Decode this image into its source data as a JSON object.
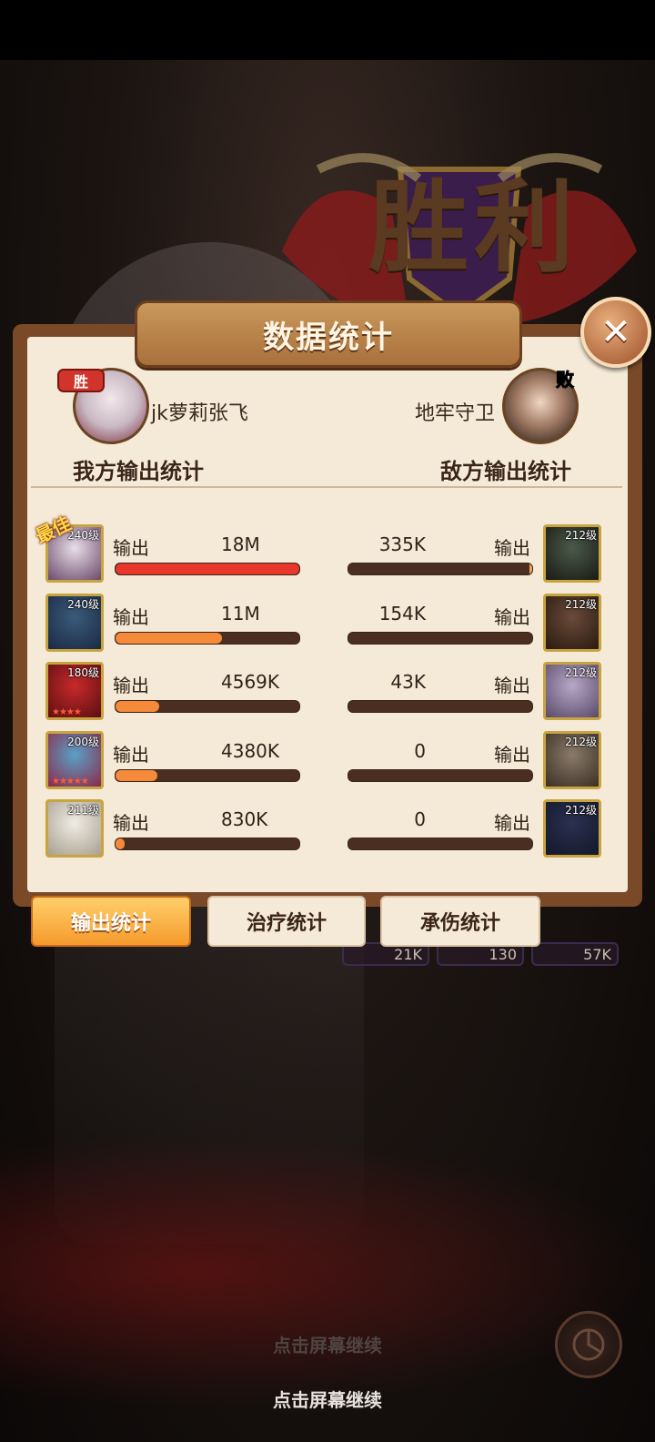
{
  "victory": {
    "text": "胜利"
  },
  "panel": {
    "title": "数据统计"
  },
  "players": {
    "ally": {
      "name": "jk萝莉张飞",
      "section_title": "我方输出统计"
    },
    "enemy": {
      "name": "地牢守卫",
      "section_title": "敌方输出统计"
    }
  },
  "best_badge": "最佳",
  "rows": [
    {
      "ally": {
        "level": "240级",
        "label": "输出",
        "value": "18M",
        "fraction": 1.0,
        "color": "#e8362a",
        "stars": 0
      },
      "enemy": {
        "level": "212级",
        "label": "输出",
        "value": "335K",
        "fraction": 1.0,
        "color": "#f5a35a"
      }
    },
    {
      "ally": {
        "level": "240级",
        "label": "输出",
        "value": "11M",
        "fraction": 0.58,
        "color": "#f58a3a",
        "stars": 0
      },
      "enemy": {
        "level": "212级",
        "label": "输出",
        "value": "154K",
        "fraction": 0.0,
        "color": "#f5a35a"
      }
    },
    {
      "ally": {
        "level": "180级",
        "label": "输出",
        "value": "4569K",
        "fraction": 0.24,
        "color": "#f58a3a",
        "stars": 4
      },
      "enemy": {
        "level": "212级",
        "label": "输出",
        "value": "43K",
        "fraction": 0.0,
        "color": "#f5a35a"
      }
    },
    {
      "ally": {
        "level": "200级",
        "label": "输出",
        "value": "4380K",
        "fraction": 0.23,
        "color": "#f58a3a",
        "stars": 5
      },
      "enemy": {
        "level": "212级",
        "label": "输出",
        "value": "0",
        "fraction": 0.0,
        "color": "#f5a35a"
      }
    },
    {
      "ally": {
        "level": "211级",
        "label": "输出",
        "value": "830K",
        "fraction": 0.05,
        "color": "#f58a3a",
        "stars": 0
      },
      "enemy": {
        "level": "212级",
        "label": "输出",
        "value": "0",
        "fraction": 0.0,
        "color": "#f5a35a"
      }
    }
  ],
  "tabs": [
    {
      "label": "输出统计",
      "active": true
    },
    {
      "label": "治疗统计",
      "active": false
    },
    {
      "label": "承伤统计",
      "active": false
    }
  ],
  "background_counts": [
    "21K",
    "130",
    "57K"
  ],
  "continue_hints": [
    "点击屏幕继续",
    "点击屏幕继续"
  ],
  "colors": {
    "panel_border": "#7a4a28",
    "panel_bg": "#f5ead7",
    "active_tab": "#f59a2c",
    "bar_track": "#4a2f20"
  }
}
